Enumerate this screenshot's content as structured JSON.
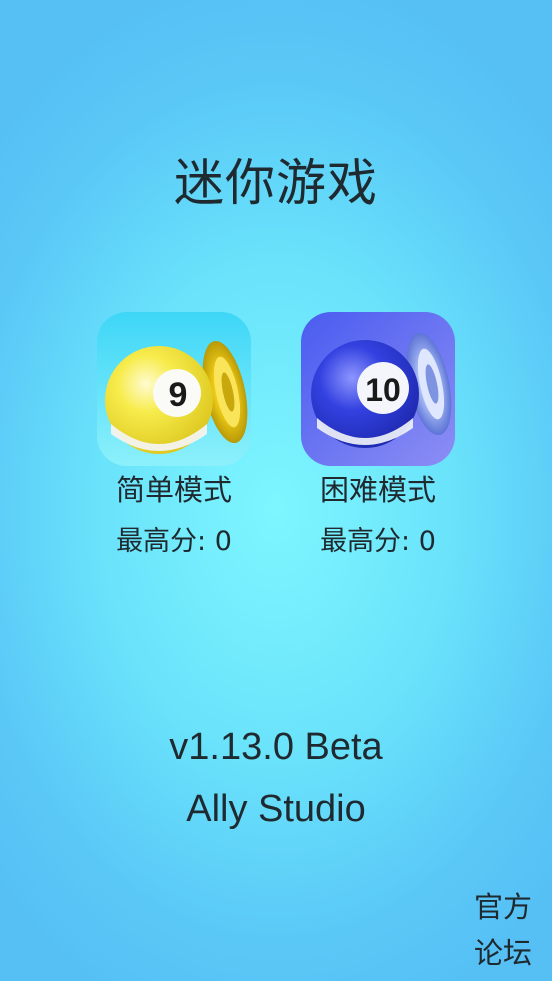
{
  "title": "迷你游戏",
  "modes": [
    {
      "label": "简单模式",
      "high_score": "最高分: 0",
      "icon": "yellow-nine-ball-icon",
      "ball_number": "9",
      "colors": {
        "bg": "#3fd0f5",
        "ball": "#f5e642",
        "target": "#f2cf1c"
      }
    },
    {
      "label": "困难模式",
      "high_score": "最高分: 0",
      "icon": "blue-ten-ball-icon",
      "ball_number": "10",
      "colors": {
        "bg": "#5a6cf2",
        "ball": "#2a3ad8",
        "target": "#9fb4f2"
      }
    }
  ],
  "version": "v1.13.0 Beta",
  "studio": "Ally Studio",
  "forum_link": "官方论坛"
}
